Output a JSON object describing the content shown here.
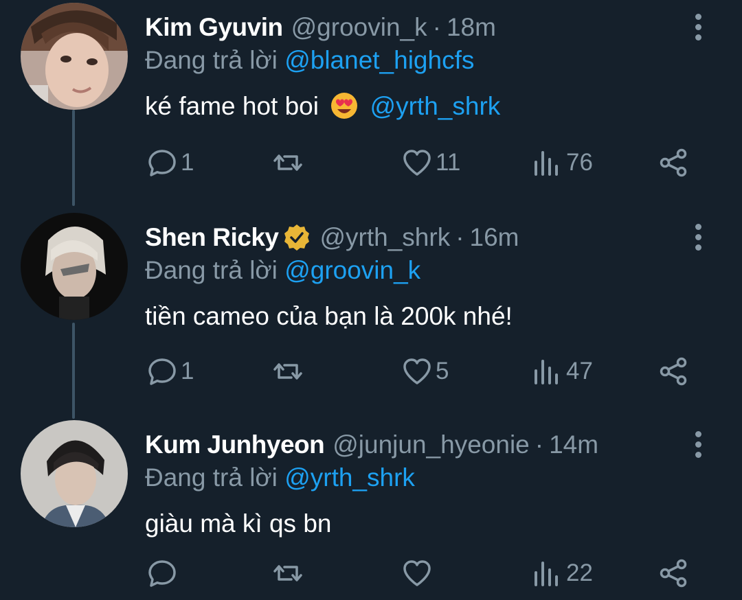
{
  "reply_prefix": "Đang trả lời",
  "tweets": [
    {
      "name": "Kim Gyuvin",
      "handle": "@groovin_k",
      "separator": "·",
      "time": "18m",
      "replying_to": "@blanet_highcfs",
      "text_before": "ké fame hot boi",
      "emoji": "smiling-face-with-heart-eyes",
      "text_mention": "@yrth_shrk",
      "verified": false,
      "replies": "1",
      "retweets": "",
      "likes": "11",
      "views": "76"
    },
    {
      "name": "Shen Ricky",
      "handle": "@yrth_shrk",
      "separator": "·",
      "time": "16m",
      "replying_to": "@groovin_k",
      "text_before": "tiền cameo của bạn là 200k nhé!",
      "verified": true,
      "replies": "1",
      "retweets": "",
      "likes": "5",
      "views": "47"
    },
    {
      "name": "Kum Junhyeon",
      "handle": "@junjun_hyeonie",
      "separator": "·",
      "time": "14m",
      "replying_to": "@yrth_shrk",
      "text_before": "giàu mà kì qs bn",
      "verified": false,
      "replies": "",
      "retweets": "",
      "likes": "",
      "views": "22"
    }
  ],
  "colors": {
    "background": "#15202b",
    "secondary_text": "#8899a6",
    "link": "#1da1f2",
    "verified_badge": "#e8b637",
    "thread_line": "#3d5466"
  },
  "icons": [
    "reply-icon",
    "retweet-icon",
    "like-icon",
    "views-icon",
    "share-icon",
    "more-options-icon",
    "verified-badge-icon"
  ]
}
